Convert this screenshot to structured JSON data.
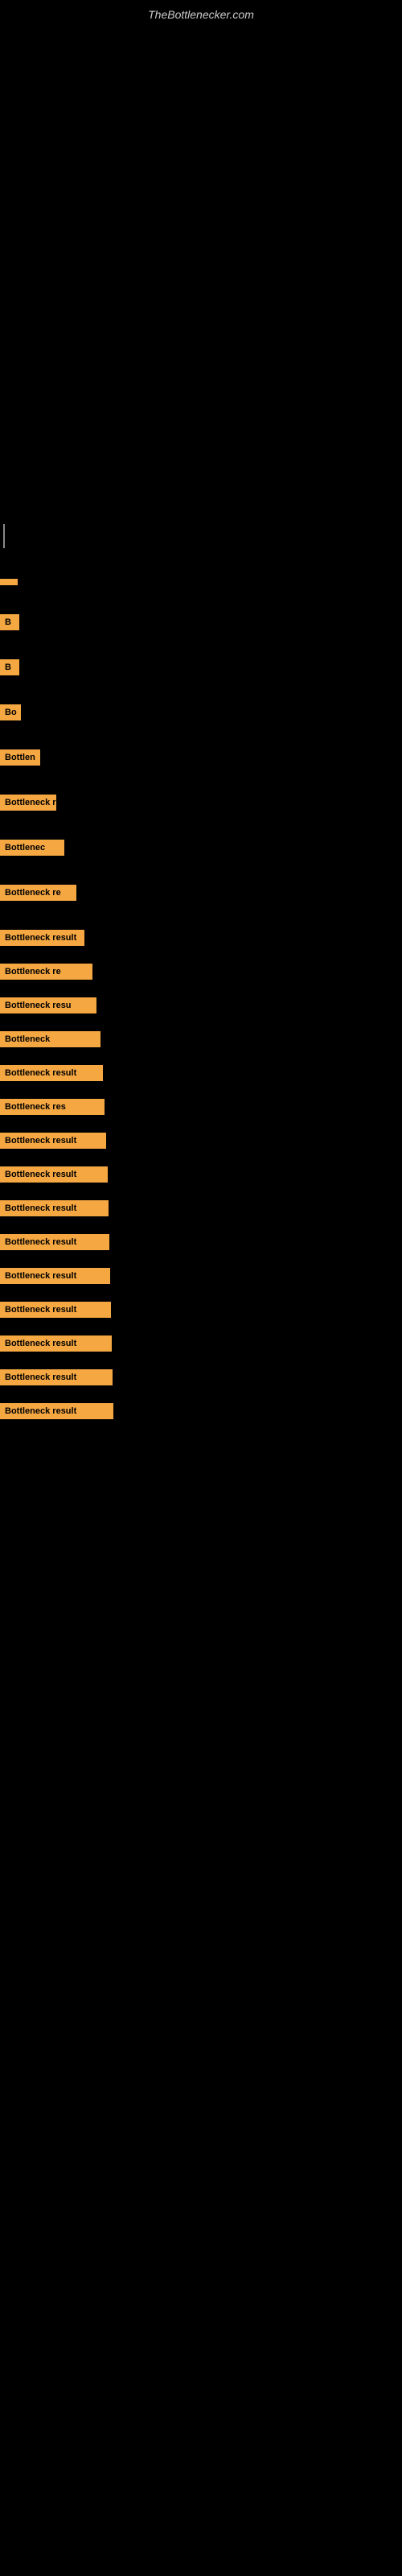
{
  "site": {
    "title": "TheBottlenecker.com"
  },
  "results": [
    {
      "id": 1,
      "label": "",
      "width_class": "bar-w1",
      "visible_text": ""
    },
    {
      "id": 2,
      "label": "B",
      "width_class": "bar-w2",
      "visible_text": "B"
    },
    {
      "id": 3,
      "label": "B",
      "width_class": "bar-w2",
      "visible_text": "B"
    },
    {
      "id": 4,
      "label": "Bo",
      "width_class": "bar-w3",
      "visible_text": "Bo"
    },
    {
      "id": 5,
      "label": "Bottlen",
      "width_class": "bar-w4",
      "visible_text": "Bottlen"
    },
    {
      "id": 6,
      "label": "Bottleneck r",
      "width_class": "bar-w5",
      "visible_text": "Bottleneck r"
    },
    {
      "id": 7,
      "label": "Bottlenec",
      "width_class": "bar-w6",
      "visible_text": "Bottlenec"
    },
    {
      "id": 8,
      "label": "Bottleneck re",
      "width_class": "bar-w7",
      "visible_text": "Bottleneck re"
    },
    {
      "id": 9,
      "label": "Bottleneck result",
      "width_class": "bar-w8",
      "visible_text": "Bottleneck result"
    },
    {
      "id": 10,
      "label": "Bottleneck re",
      "width_class": "bar-w9",
      "visible_text": "Bottleneck re"
    },
    {
      "id": 11,
      "label": "Bottleneck resu",
      "width_class": "bar-w10",
      "visible_text": "Bottleneck resu"
    },
    {
      "id": 12,
      "label": "Bottleneck",
      "width_class": "bar-w11",
      "visible_text": "Bottleneck"
    },
    {
      "id": 13,
      "label": "Bottleneck result",
      "width_class": "bar-w12",
      "visible_text": "Bottleneck result"
    },
    {
      "id": 14,
      "label": "Bottleneck res",
      "width_class": "bar-w13",
      "visible_text": "Bottleneck res"
    },
    {
      "id": 15,
      "label": "Bottleneck result",
      "width_class": "bar-w14",
      "visible_text": "Bottleneck result"
    },
    {
      "id": 16,
      "label": "Bottleneck result",
      "width_class": "bar-w15",
      "visible_text": "Bottleneck result"
    },
    {
      "id": 17,
      "label": "Bottleneck result",
      "width_class": "bar-w16",
      "visible_text": "Bottleneck result"
    },
    {
      "id": 18,
      "label": "Bottleneck result",
      "width_class": "bar-w17",
      "visible_text": "Bottleneck result"
    },
    {
      "id": 19,
      "label": "Bottleneck result",
      "width_class": "bar-w18",
      "visible_text": "Bottleneck result"
    },
    {
      "id": 20,
      "label": "Bottleneck result",
      "width_class": "bar-w19",
      "visible_text": "Bottleneck result"
    },
    {
      "id": 21,
      "label": "Bottleneck result",
      "width_class": "bar-w20",
      "visible_text": "Bottleneck result"
    },
    {
      "id": 22,
      "label": "Bottleneck result",
      "width_class": "bar-w21",
      "visible_text": "Bottleneck result"
    },
    {
      "id": 23,
      "label": "Bottleneck result",
      "width_class": "bar-w22",
      "visible_text": "Bottleneck result"
    }
  ]
}
